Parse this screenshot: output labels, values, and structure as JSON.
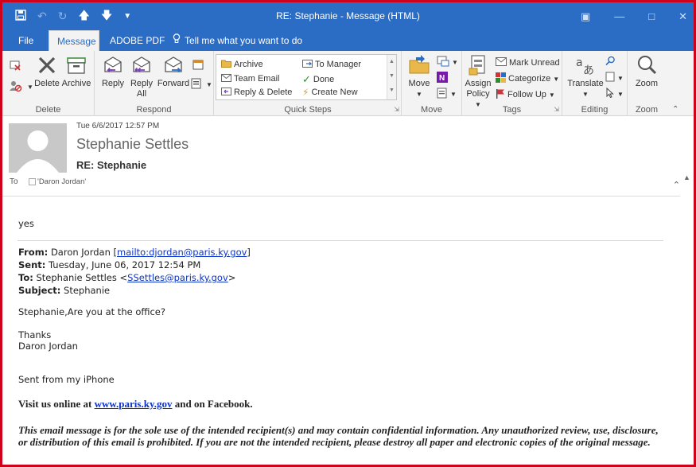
{
  "window": {
    "title": "RE: Stephanie  -  Message (HTML)",
    "qat": {
      "save_icon": "save-icon",
      "undo_icon": "undo-icon",
      "redo_icon": "redo-icon",
      "up_icon": "arrow-up-icon",
      "down_icon": "arrow-down-icon",
      "customize_icon": "qat-dropdown-icon"
    },
    "accent_color": "#2b6cc4"
  },
  "tabs": [
    {
      "label": "File"
    },
    {
      "label": "Message",
      "active": true
    },
    {
      "label": "ADOBE PDF"
    },
    {
      "label": "Tell me what you want to do"
    }
  ],
  "ribbon": {
    "delete_group": {
      "label": "Delete",
      "delete": "Delete",
      "archive": "Archive"
    },
    "respond_group": {
      "label": "Respond",
      "reply": "Reply",
      "reply_all_line1": "Reply",
      "reply_all_line2": "All",
      "forward": "Forward"
    },
    "quick_steps": {
      "label": "Quick Steps",
      "archive": "Archive",
      "team_email": "Team Email",
      "reply_delete": "Reply & Delete",
      "to_manager": "To Manager",
      "done": "Done",
      "create_new": "Create New"
    },
    "move_group": {
      "label": "Move",
      "move": "Move"
    },
    "tags_group": {
      "label": "Tags",
      "assign_policy_line1": "Assign",
      "assign_policy_line2": "Policy",
      "mark_unread": "Mark Unread",
      "categorize": "Categorize",
      "follow_up": "Follow Up"
    },
    "editing_group": {
      "label": "Editing",
      "translate": "Translate"
    },
    "zoom_group": {
      "label": "Zoom",
      "zoom": "Zoom"
    }
  },
  "message": {
    "date": "Tue 6/6/2017 12:57 PM",
    "sender": "Stephanie Settles",
    "subject": "RE: Stephanie",
    "to_label": "To",
    "to_value": "'Daron Jordan'"
  },
  "body": {
    "reply": "yes",
    "from_label": "From:",
    "from_name": "Daron Jordan [",
    "from_link": "mailto:djordan@paris.ky.gov",
    "from_end": "]",
    "sent_label": "Sent:",
    "sent_value": "Tuesday, June 06, 2017 12:54 PM",
    "to_label": "To:",
    "to_name": "Stephanie Settles <",
    "to_link": "SSettles@paris.ky.gov",
    "to_end": ">",
    "subject_label": "Subject:",
    "subject_value": "Stephanie",
    "greeting": "Stephanie,Are you at the office?",
    "thanks": "Thanks",
    "signature": "Daron Jordan",
    "sent_from": "Sent from my iPhone",
    "visit_pre": "Visit us online at ",
    "visit_link": "www.paris.ky.gov",
    "visit_post": " and on Facebook.",
    "disclaimer": "This email message is for the sole use of the intended recipient(s) and may contain confidential information. Any unauthorized review, use, disclosure, or distribution of this email is prohibited. If you are not the intended recipient, please destroy all paper and electronic copies of the original message."
  }
}
